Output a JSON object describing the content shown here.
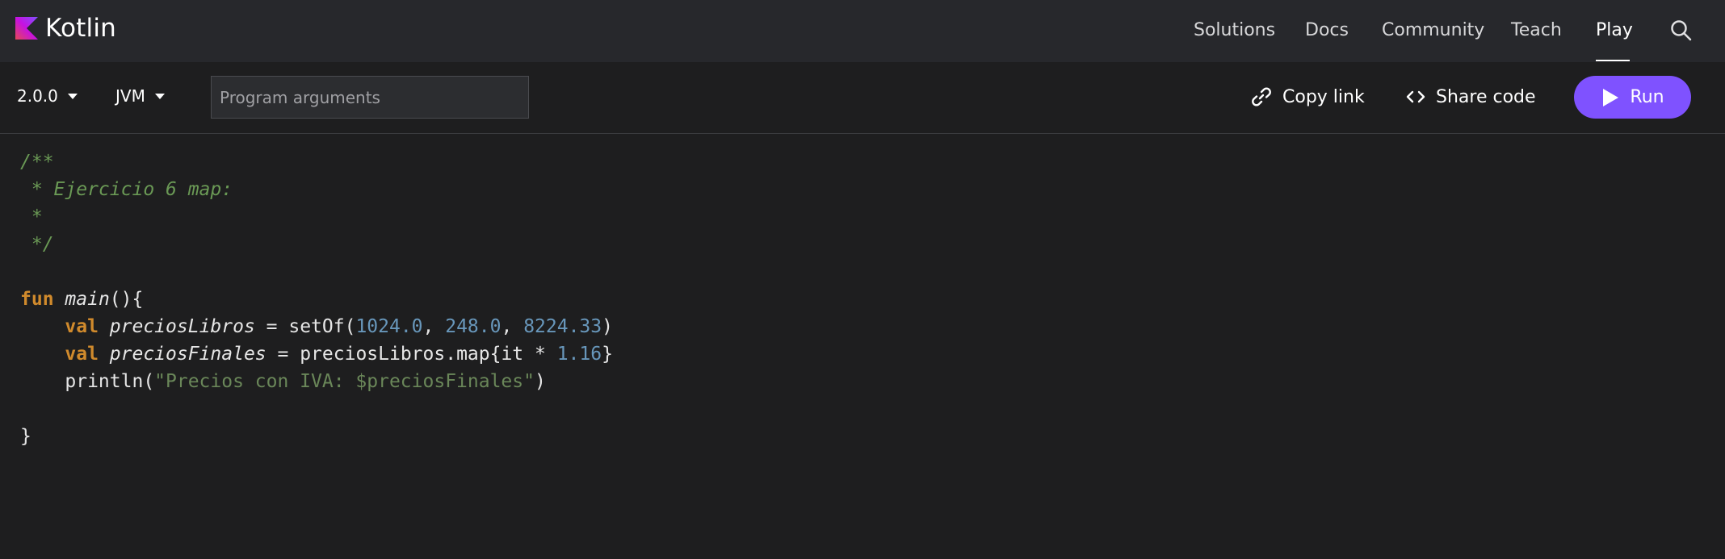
{
  "brand": {
    "name": "Kotlin"
  },
  "nav": {
    "items": [
      {
        "label": "Solutions"
      },
      {
        "label": "Docs"
      },
      {
        "label": "Community"
      },
      {
        "label": "Teach"
      },
      {
        "label": "Play"
      }
    ],
    "active": "Play",
    "search_icon": "search-icon"
  },
  "toolbar": {
    "version": "2.0.0",
    "target": "JVM",
    "args_placeholder": "Program arguments",
    "args_value": "",
    "copy_link": "Copy link",
    "share_code": "Share code",
    "run": "Run",
    "accent_color": "#7f52ff"
  },
  "code": {
    "lines": [
      "/**",
      " * Ejercicio 6 map:",
      " *",
      " */",
      "",
      "fun main(){",
      "    val preciosLibros = setOf(1024.0, 248.0, 8224.33)",
      "    val preciosFinales = preciosLibros.map{it * 1.16}",
      "    println(\"Precios con IVA: $preciosFinales\")",
      "",
      "}"
    ]
  }
}
